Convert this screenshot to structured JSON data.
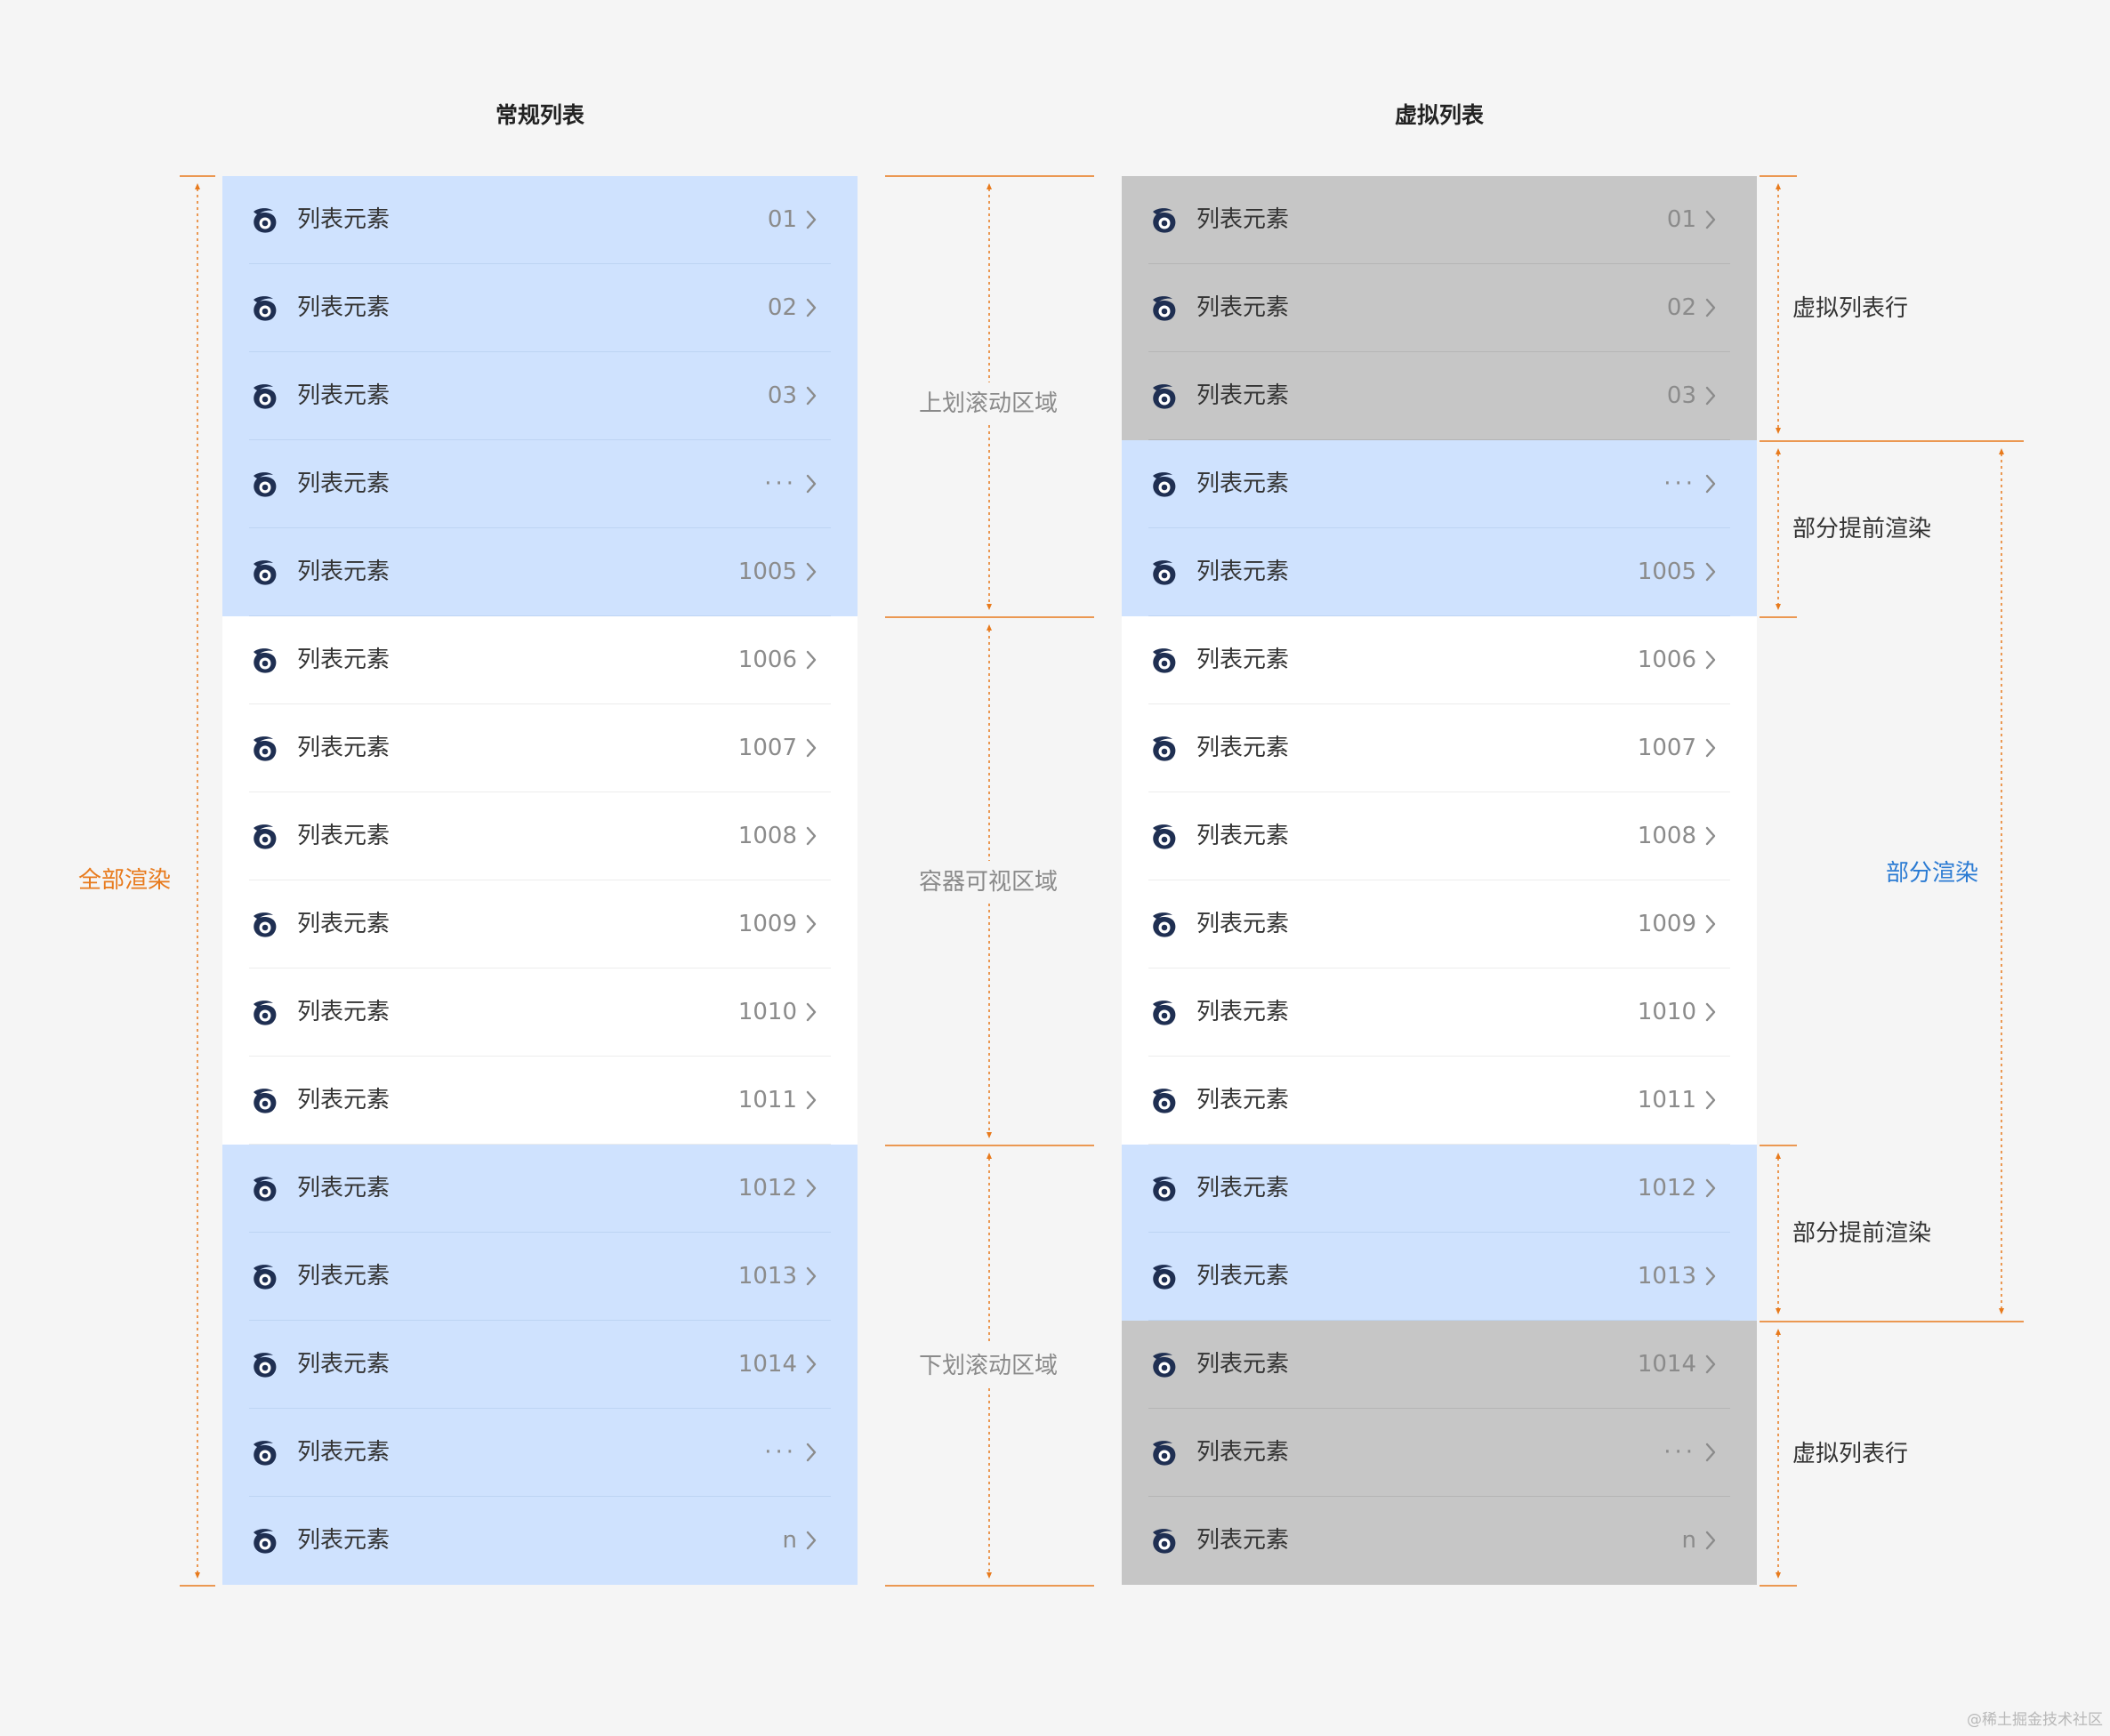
{
  "titles": {
    "left": "常规列表",
    "right": "虚拟列表"
  },
  "item_label": "列表元素",
  "rows": [
    {
      "value": "01",
      "left_bg": "blue",
      "right_bg": "gray"
    },
    {
      "value": "02",
      "left_bg": "blue",
      "right_bg": "gray"
    },
    {
      "value": "03",
      "left_bg": "blue",
      "right_bg": "gray"
    },
    {
      "value": "···",
      "left_bg": "blue",
      "right_bg": "blue"
    },
    {
      "value": "1005",
      "left_bg": "blue",
      "right_bg": "blue"
    },
    {
      "value": "1006",
      "left_bg": "white",
      "right_bg": "white"
    },
    {
      "value": "1007",
      "left_bg": "white",
      "right_bg": "white"
    },
    {
      "value": "1008",
      "left_bg": "white",
      "right_bg": "white"
    },
    {
      "value": "1009",
      "left_bg": "white",
      "right_bg": "white"
    },
    {
      "value": "1010",
      "left_bg": "white",
      "right_bg": "white"
    },
    {
      "value": "1011",
      "left_bg": "white",
      "right_bg": "white"
    },
    {
      "value": "1012",
      "left_bg": "blue",
      "right_bg": "blue"
    },
    {
      "value": "1013",
      "left_bg": "blue",
      "right_bg": "blue"
    },
    {
      "value": "1014",
      "left_bg": "blue",
      "right_bg": "gray"
    },
    {
      "value": "···",
      "left_bg": "blue",
      "right_bg": "gray"
    },
    {
      "value": "n",
      "left_bg": "blue",
      "right_bg": "gray"
    }
  ],
  "annotations": {
    "all_render": "全部渲染",
    "scroll_up_area": "上划滚动区域",
    "container_viewport": "容器可视区域",
    "scroll_down_area": "下划滚动区域",
    "virtual_row_top": "虚拟列表行",
    "pre_render_top": "部分提前渲染",
    "partial_render": "部分渲染",
    "pre_render_bottom": "部分提前渲染",
    "virtual_row_bottom": "虚拟列表行"
  },
  "watermark": "@稀土掘金技术社区",
  "colors": {
    "blue_bg": "#cfe2fe",
    "gray_bg": "#c6c6c6",
    "white_bg": "#ffffff",
    "orange_accent": "#e87a1c",
    "blue_label": "#2b7bd3",
    "icon": "#1f2f52"
  },
  "icons": {
    "row_icon": "swirl-logo-icon",
    "row_chevron": "chevron-right-icon"
  }
}
